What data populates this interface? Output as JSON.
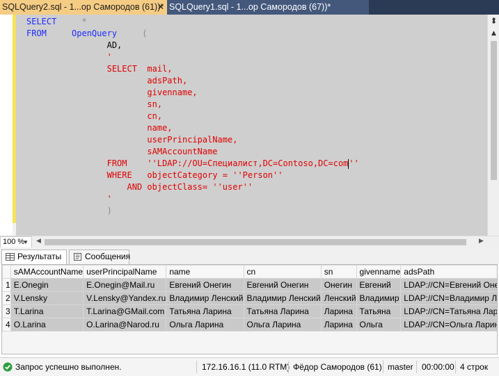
{
  "tabs": [
    {
      "label": "SQLQuery2.sql - 1...ор Самородов (61))*",
      "active": true
    },
    {
      "label": "SQLQuery1.sql - 1...ор Самородов (67))*",
      "active": false
    }
  ],
  "icons": {
    "tab_pin": "pin-icon",
    "tab_close": "close-icon",
    "split": "split-icon",
    "results": "grid-icon",
    "messages": "messages-icon",
    "status_ok": "success-check-icon"
  },
  "colors": {
    "keyword": "#1c2cff",
    "string": "#e00000",
    "tab_active": "#f5cc84",
    "tab_strip": "#2b3a55",
    "status_ok": "#2e9e3e"
  },
  "code": {
    "l1_kw": "SELECT",
    "l1_rest": "*",
    "l2_kw": "FROM",
    "l2_func": "OpenQuery",
    "l2_paren": "(",
    "l3": "AD,",
    "l4": "'",
    "l5_kw": "SELECT",
    "l5_rest": "mail,",
    "l6": "adsPath,",
    "l7": "givenname,",
    "l8": "sn,",
    "l9": "cn,",
    "l10": "name,",
    "l11": "userPrincipalName,",
    "l12": "sAMAccountName",
    "l13_kw": "FROM",
    "l13_pre": "''LDAP://OU=Специалист,DC=Contoso,DC=com",
    "l13_post": "''",
    "l14_kw": "WHERE",
    "l14_rest": "objectCategory = ''Person''",
    "l15_kw": "AND",
    "l15_rest": "objectClass= ''user''",
    "l16": "'",
    "l17": ")"
  },
  "zoom": {
    "value": "100 %"
  },
  "result_tabs": [
    {
      "label": "Результаты",
      "active": true
    },
    {
      "label": "Сообщения",
      "active": false
    }
  ],
  "grid": {
    "columns": [
      "sAMAccountName",
      "userPrincipalName",
      "name",
      "cn",
      "sn",
      "givenname",
      "adsPath"
    ],
    "rows": [
      {
        "num": "1",
        "cells": [
          "E.Onegin",
          "E.Onegin@Mail.ru",
          "Евгений Онегин",
          "Евгений Онегин",
          "Онегин",
          "Евгений",
          "LDAP://CN=Евгений Онегин"
        ]
      },
      {
        "num": "2",
        "cells": [
          "V.Lensky",
          "V.Lensky@Yandex.ru",
          "Владимир Ленский",
          "Владимир Ленский",
          "Ленский",
          "Владимир",
          "LDAP://CN=Владимир Ленский"
        ]
      },
      {
        "num": "3",
        "cells": [
          "T.Larina",
          "T.Larina@GMail.com",
          "Татьяна Ларина",
          "Татьяна Ларина",
          "Ларина",
          "Татьяна",
          "LDAP://CN=Татьяна Ларина"
        ]
      },
      {
        "num": "4",
        "cells": [
          "O.Larina",
          "O.Larina@Narod.ru",
          "Ольга Ларина",
          "Ольга Ларина",
          "Ларина",
          "Ольга",
          "LDAP://CN=Ольга Ларина"
        ]
      }
    ]
  },
  "status": {
    "message": "Запрос успешно выполнен.",
    "server": "172.16.16.1 (11.0 RTM)",
    "user": "Фёдор Самородов (61)",
    "database": "master",
    "time": "00:00:00",
    "rows": "4 строк"
  }
}
